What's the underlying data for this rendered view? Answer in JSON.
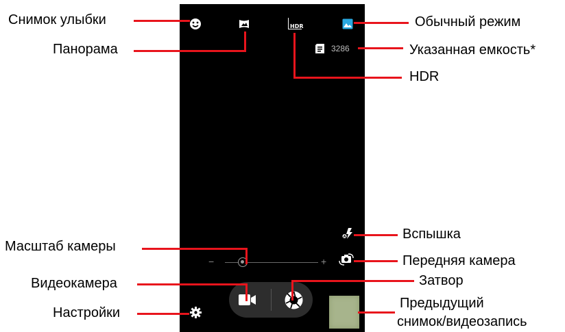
{
  "labels": {
    "smile_shot": "Снимок улыбки",
    "panorama": "Панорама",
    "normal_mode": "Обычный режим",
    "capacity": "Указанная емкость*",
    "hdr": "HDR",
    "flash": "Вспышка",
    "zoom": "Масштаб камеры",
    "front_camera": "Передняя камера",
    "video_camera": "Видеокамера",
    "shutter": "Затвор",
    "settings": "Настройки",
    "previous_line1": "Предыдущий",
    "previous_line2": "снимок/видеозапись"
  },
  "camera_ui": {
    "remaining_count": "3286",
    "hdr_icon_text": "HDR",
    "zoom_minus": "−",
    "zoom_plus": "+",
    "zoom_level": 0.08
  },
  "icons": {
    "smile": "smile-face-icon",
    "panorama": "panorama-icon",
    "hdr": "hdr-icon",
    "normal_mode": "image-mode-icon",
    "storage": "sd-card-icon",
    "flash": "flash-auto-icon",
    "front_camera": "switch-camera-icon",
    "video": "video-camera-icon",
    "shutter": "shutter-aperture-icon",
    "settings": "gear-icon"
  },
  "colors": {
    "leader_line": "#e8141c",
    "screen_bg": "#000000",
    "accent_blue": "#29a8e0",
    "thumbnail": "#a7b48c"
  }
}
